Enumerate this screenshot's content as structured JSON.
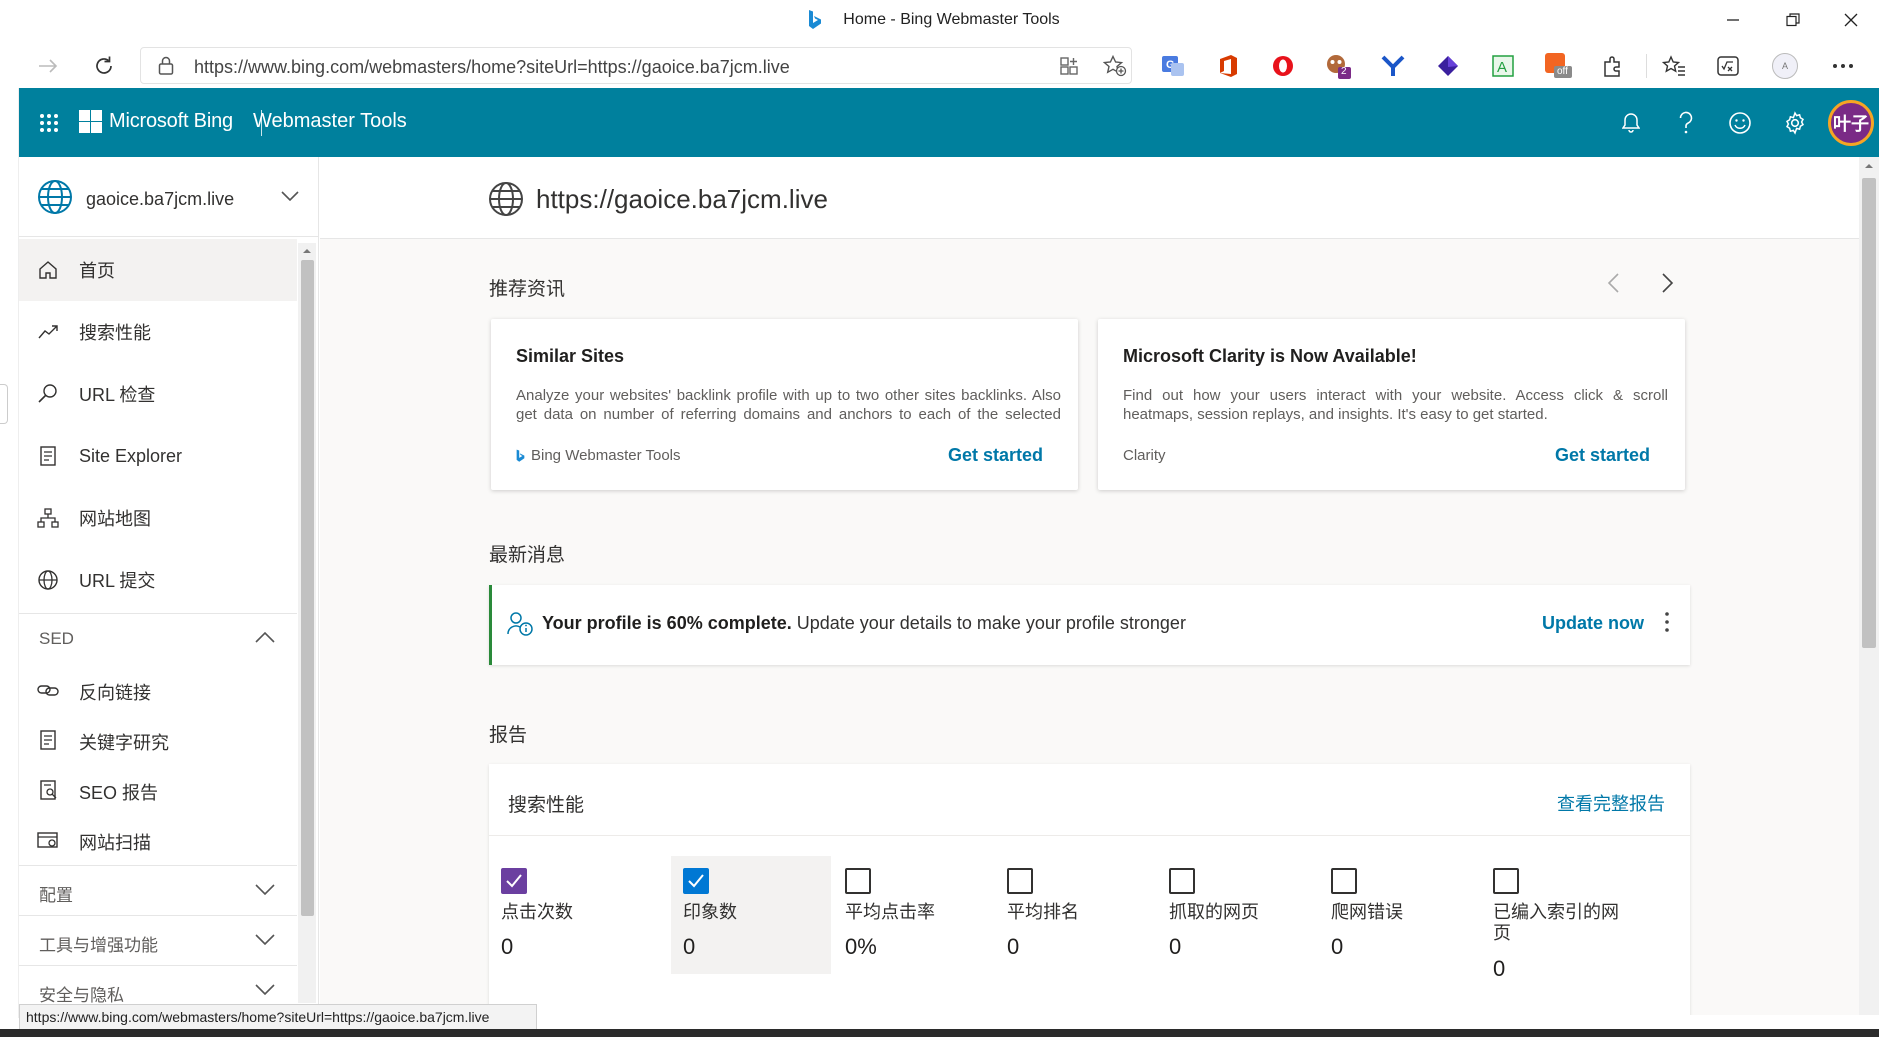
{
  "browser": {
    "window_title": "Home - Bing Webmaster Tools",
    "address": "https://www.bing.com/webmasters/home?siteUrl=https://gaoice.ba7jcm.live",
    "status_url": "https://www.bing.com/webmasters/home?siteUrl=https://gaoice.ba7jcm.live",
    "extension_badge": "2",
    "extension_off_label": "off",
    "profile_initial": "A"
  },
  "app": {
    "brand": "Microsoft Bing",
    "product": "Webmaster Tools",
    "avatar_text": "叶子",
    "accent_color": "#00809d"
  },
  "sidebar": {
    "site_name": "gaoice.ba7jcm.live",
    "nav": [
      {
        "label": "首页",
        "icon": "home-icon"
      },
      {
        "label": "搜索性能",
        "icon": "trend-icon"
      },
      {
        "label": "URL 检查",
        "icon": "search-icon"
      },
      {
        "label": "Site Explorer",
        "icon": "document-icon"
      },
      {
        "label": "网站地图",
        "icon": "sitemap-icon"
      },
      {
        "label": "URL 提交",
        "icon": "globe-icon"
      }
    ],
    "sed_section": "SED",
    "sed_items": [
      {
        "label": "反向链接",
        "icon": "link-icon"
      },
      {
        "label": "关键字研究",
        "icon": "document-icon"
      },
      {
        "label": "SEO 报告",
        "icon": "report-icon"
      },
      {
        "label": "网站扫描",
        "icon": "scan-icon"
      }
    ],
    "config_section": "配置",
    "tools_section": "工具与增强功能",
    "security_section": "安全与隐私"
  },
  "main": {
    "site_url": "https://gaoice.ba7jcm.live",
    "recommended_title": "推荐资讯",
    "cards": [
      {
        "title": "Similar Sites",
        "desc": "Analyze your websites' backlink profile with up to two other sites backlinks. Also get data on number of referring domains and anchors to each of the selected sites.",
        "source": "Bing Webmaster Tools",
        "cta": "Get started"
      },
      {
        "title": "Microsoft Clarity is Now Available!",
        "desc": "Find out how your users interact with your website. Access click & scroll heatmaps, session replays, and insights. It's easy to get started.",
        "source": "Clarity",
        "cta": "Get started"
      }
    ],
    "news_title": "最新消息",
    "profile_bold": "Your profile is 60% complete.",
    "profile_text": " Update your details to make your profile stronger",
    "profile_cta": "Update now",
    "reports_title": "报告",
    "report_card_title": "搜索性能",
    "report_card_link": "查看完整报告",
    "metrics": [
      {
        "label": "点击次数",
        "value": "0",
        "checked": true,
        "color": "#6b3fa0"
      },
      {
        "label": "印象数",
        "value": "0",
        "checked": true,
        "color": "#0078d4"
      },
      {
        "label": "平均点击率",
        "value": "0%",
        "checked": false
      },
      {
        "label": "平均排名",
        "value": "0",
        "checked": false
      },
      {
        "label": "抓取的网页",
        "value": "0",
        "checked": false
      },
      {
        "label": "爬网错误",
        "value": "0",
        "checked": false
      },
      {
        "label": "已编入索引的网页",
        "value": "0",
        "checked": false
      }
    ]
  }
}
